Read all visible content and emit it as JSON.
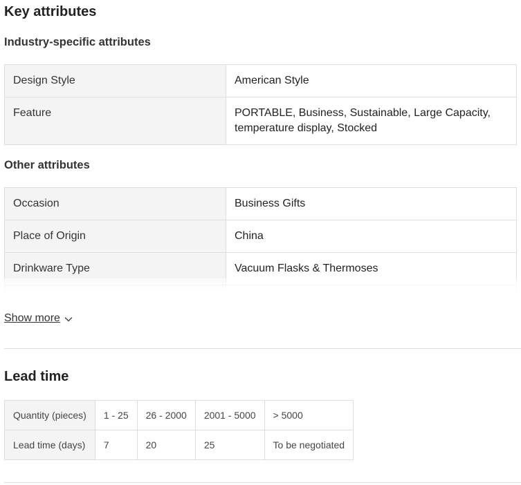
{
  "key_attributes": {
    "title": "Key attributes",
    "industry_title": "Industry-specific attributes",
    "industry_rows": [
      {
        "label": "Design Style",
        "value": "American Style"
      },
      {
        "label": "Feature",
        "value": "PORTABLE, Business, Sustainable, Large Capacity, temperature display, Stocked"
      }
    ],
    "other_title": "Other attributes",
    "other_rows": [
      {
        "label": "Occasion",
        "value": "Business Gifts"
      },
      {
        "label": "Place of Origin",
        "value": "China"
      },
      {
        "label": "Drinkware Type",
        "value": "Vacuum Flasks & Thermoses"
      },
      {
        "label": "",
        "value": ""
      }
    ],
    "show_more_label": "Show more",
    "show_more_icon": "chevron-down-icon"
  },
  "lead_time": {
    "title": "Lead time",
    "quantity_header": "Quantity (pieces)",
    "quantities": [
      "1 - 25",
      "26 - 2000",
      "2001 - 5000",
      "> 5000"
    ],
    "days_header": "Lead time (days)",
    "days": [
      "7",
      "20",
      "25",
      "To be negotiated"
    ]
  }
}
